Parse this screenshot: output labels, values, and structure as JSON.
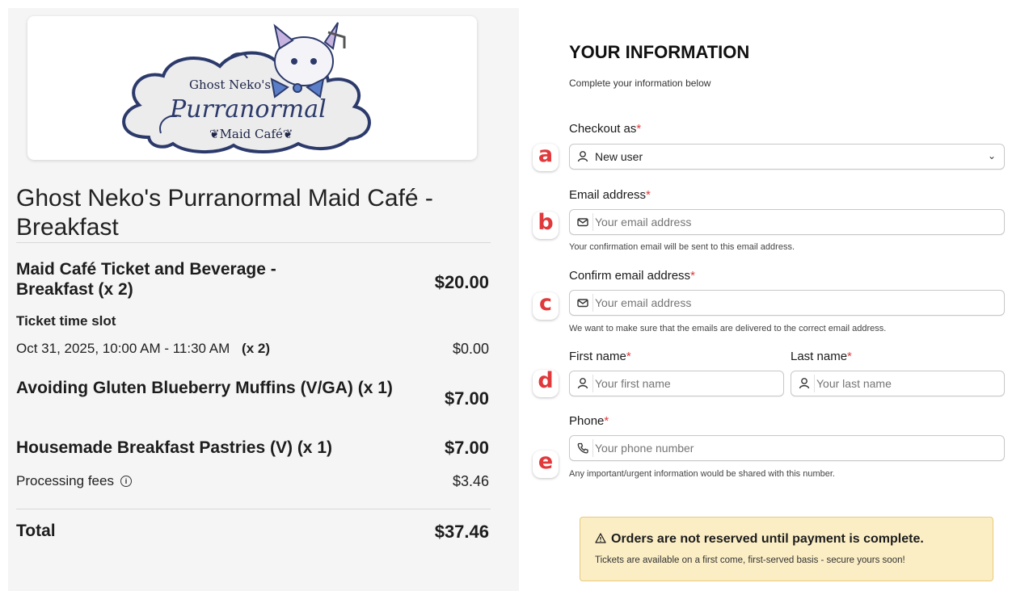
{
  "logo": {
    "line1": "Ghost Neko's",
    "line2": "Purranormal",
    "line3": "❦Maid Café❦"
  },
  "event": {
    "title": "Ghost Neko's Purranormal Maid Café - Breakfast"
  },
  "order": {
    "items": [
      {
        "name": "Maid Café Ticket and Beverage - Breakfast (x 2)",
        "price": "$20.00"
      },
      {
        "name": "Avoiding Gluten Blueberry Muffins (V/GA) (x 1)",
        "price": "$7.00"
      },
      {
        "name": "Housemade Breakfast Pastries (V) (x 1)",
        "price": "$7.00"
      }
    ],
    "timeslot_label": "Ticket time slot",
    "timeslot_value": "Oct 31, 2025, 10:00 AM - 11:30 AM",
    "timeslot_qty": "(x 2)",
    "timeslot_price": "$0.00",
    "fees_label": "Processing fees",
    "fees_value": "$3.46",
    "total_label": "Total",
    "total_value": "$37.46"
  },
  "form": {
    "heading": "YOUR INFORMATION",
    "subheading": "Complete your information below",
    "checkout_as": {
      "label": "Checkout as",
      "value": "New user",
      "marker": "a"
    },
    "email": {
      "label": "Email address",
      "placeholder": "Your email address",
      "help": "Your confirmation email will be sent to this email address.",
      "marker": "b"
    },
    "confirm_email": {
      "label": "Confirm email address",
      "placeholder": "Your email address",
      "help": "We want to make sure that the emails are delivered to the correct email address.",
      "marker": "c"
    },
    "first_name": {
      "label": "First name",
      "placeholder": "Your first name",
      "marker": "d"
    },
    "last_name": {
      "label": "Last name",
      "placeholder": "Your last name"
    },
    "phone": {
      "label": "Phone",
      "placeholder": "Your phone number",
      "help": "Any important/urgent information would be shared with this number.",
      "marker": "e"
    },
    "required_mark": "*"
  },
  "notice": {
    "icon": "warning-icon",
    "title": "Orders are not reserved until payment is complete.",
    "text": "Tickets are available on a first come, first-served basis - secure yours soon!"
  },
  "colors": {
    "required": "#e0393b",
    "notice_bg": "#fbeec5",
    "logo_navy": "#2c3a6b"
  }
}
